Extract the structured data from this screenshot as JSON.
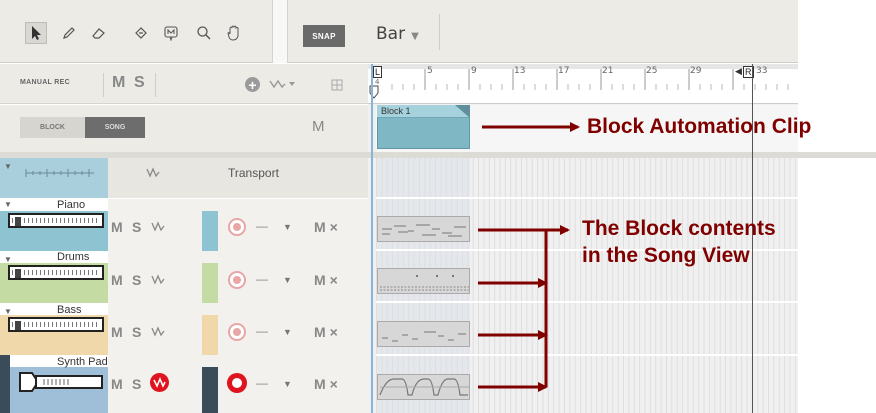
{
  "toolbar": {
    "tools": [
      "pointer-icon",
      "pencil-icon",
      "eraser-icon",
      "paint-bucket-icon",
      "marker-icon",
      "zoom-icon",
      "hand-icon"
    ],
    "snap_label": "SNAP",
    "grid_value": "Bar"
  },
  "header": {
    "manual_rec_label": "MANUAL REC",
    "m_label": "M",
    "s_label": "S"
  },
  "view_tabs": {
    "block_label": "BLOCK",
    "song_label": "SONG",
    "m_label": "M"
  },
  "ruler": {
    "bars": [
      "5",
      "9",
      "13",
      "17",
      "21",
      "25",
      "29",
      "33"
    ],
    "loop_start_marker": "L",
    "loop_end_marker": "R",
    "sub_label": "4"
  },
  "transport_track": {
    "name": "Transport"
  },
  "tracks": [
    {
      "name": "Piano",
      "m": "M",
      "s": "S",
      "x": "×",
      "color": "#8ec3d2"
    },
    {
      "name": "Drums",
      "m": "M",
      "s": "S",
      "x": "×",
      "color": "#c4dca4"
    },
    {
      "name": "Bass",
      "m": "M",
      "s": "S",
      "x": "×",
      "color": "#f0d8aa"
    },
    {
      "name": "Synth Pad",
      "m": "M",
      "s": "S",
      "x": "×",
      "color": "#9fbfd9"
    }
  ],
  "block_clip": {
    "label": "Block 1"
  },
  "annotations": {
    "clip_callout": "Block Automation Clip",
    "contents_callout_line1": "The Block contents",
    "contents_callout_line2": "in the Song View"
  },
  "colors": {
    "annotation": "#800000",
    "clip": "#7fb8c4",
    "record_active": "#e0141e"
  }
}
